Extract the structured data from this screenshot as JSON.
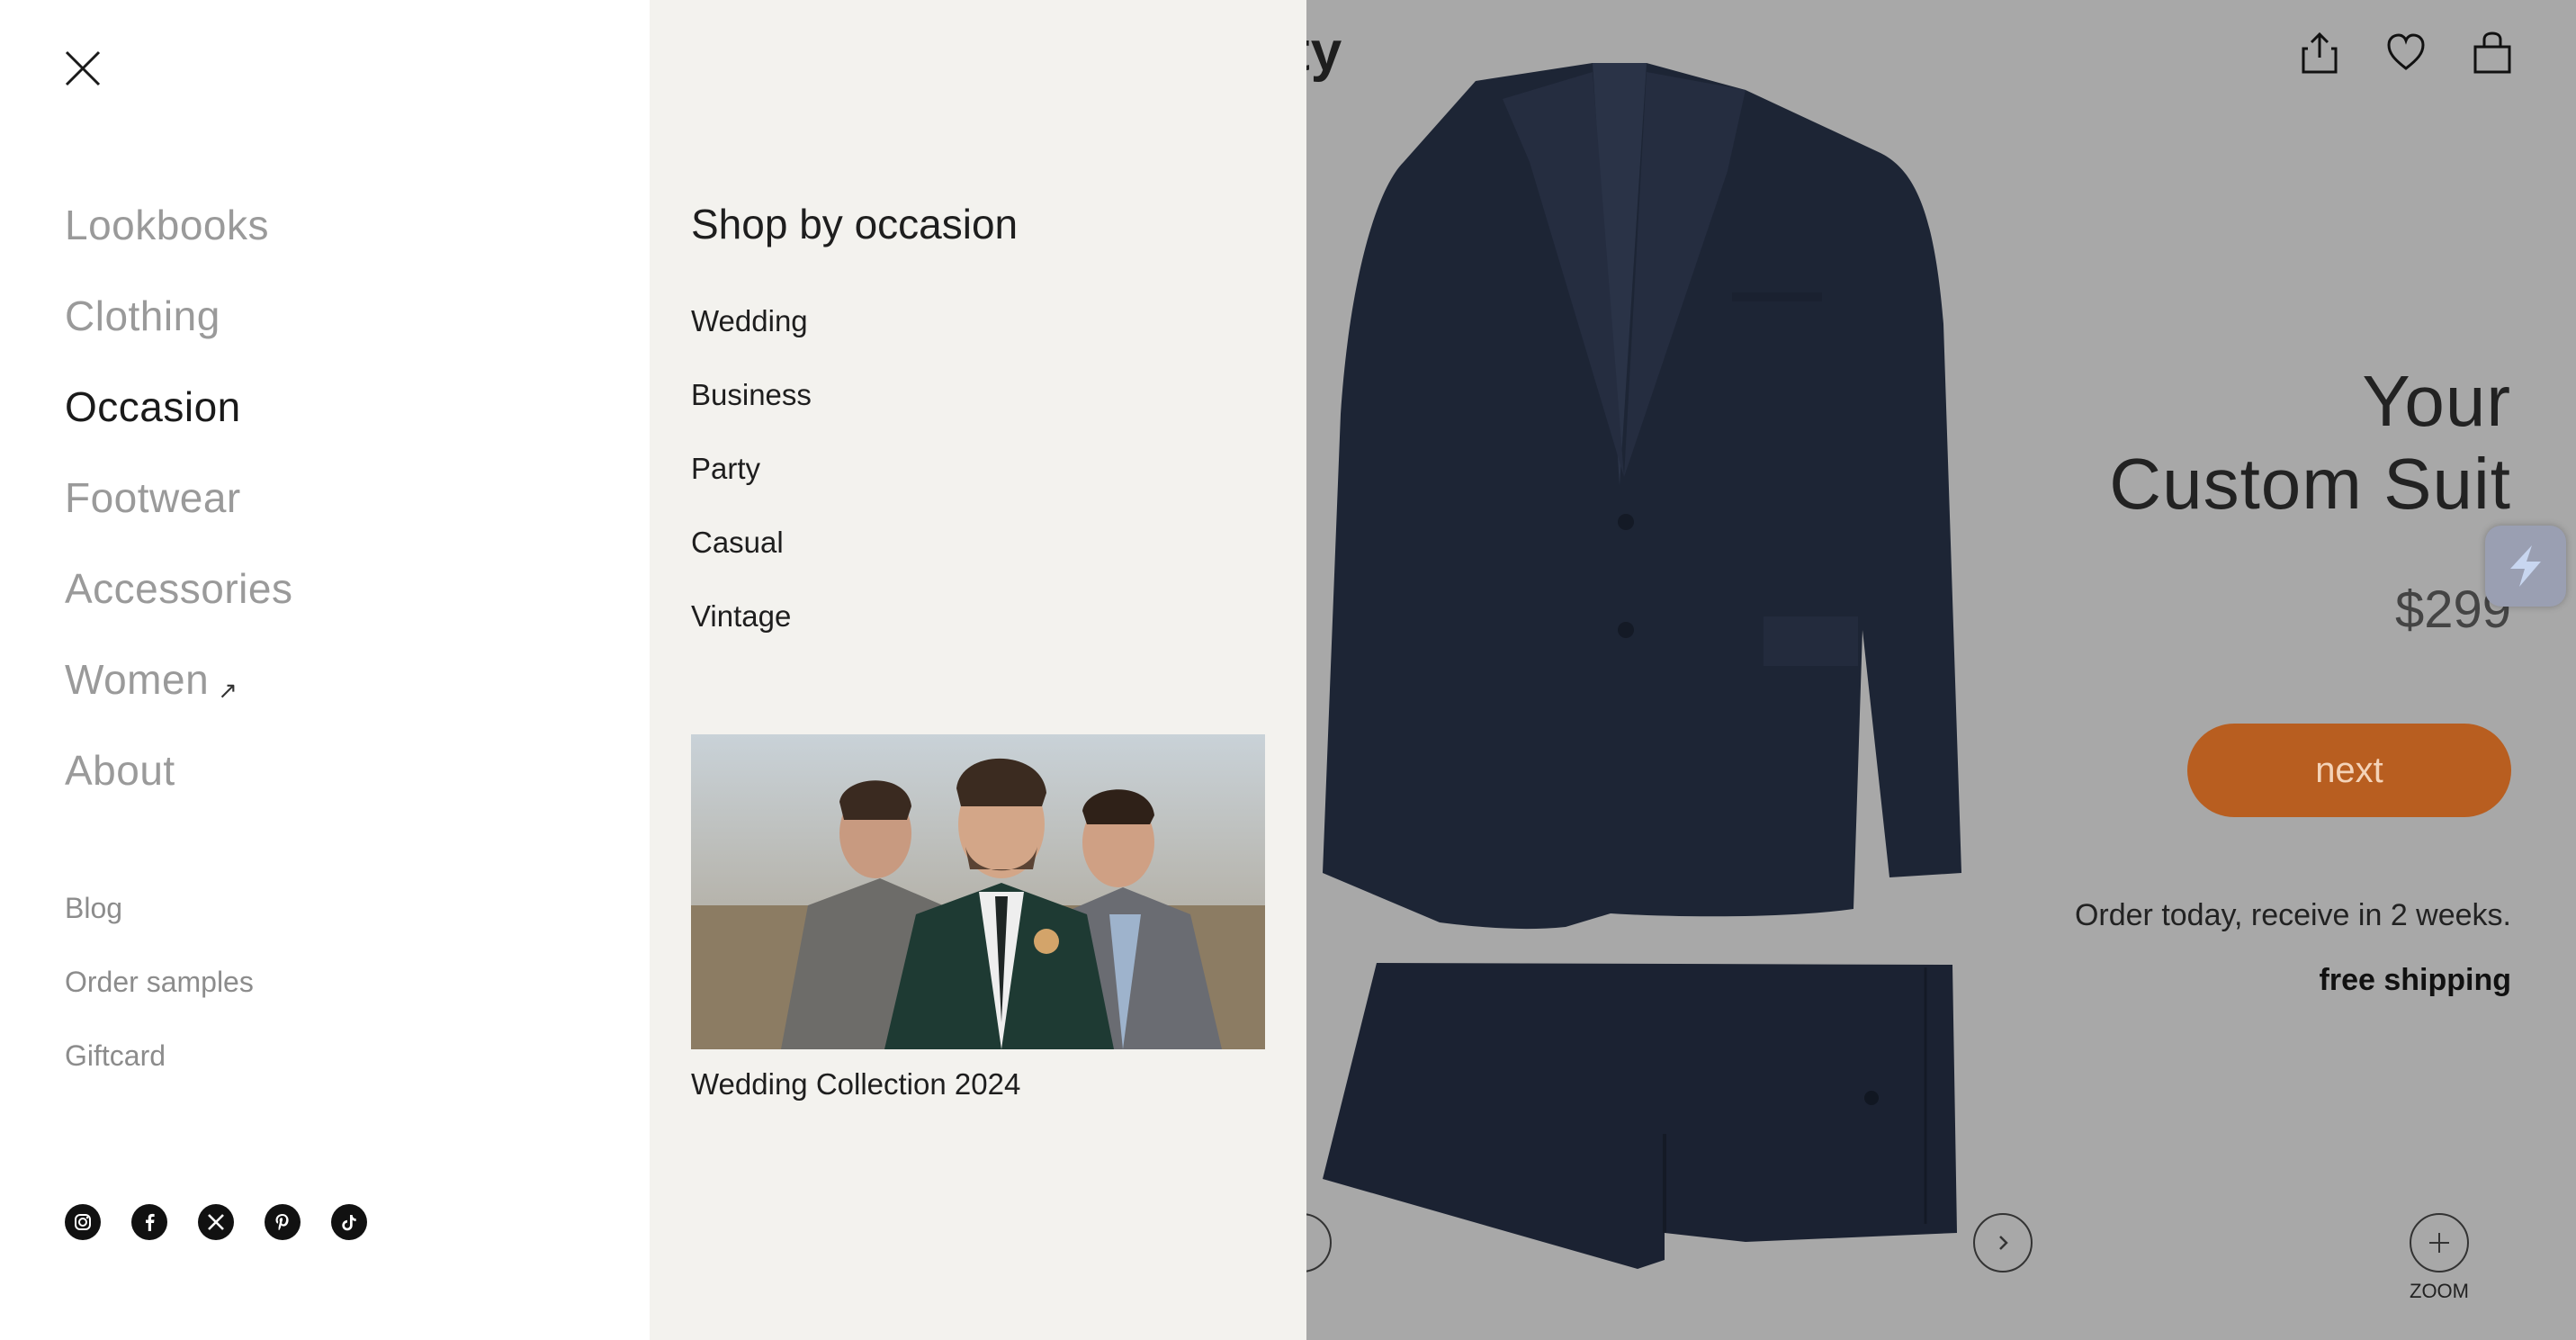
{
  "product": {
    "brand_partial": "rty",
    "title_line1": "Your",
    "title_line2": "Custom Suit",
    "price": "$299",
    "next_label": "next",
    "order_text": "Order today, receive in 2 weeks.",
    "shipping_text": "free shipping",
    "zoom_label": "ZOOM",
    "accent_color": "#b85e20"
  },
  "menu": {
    "main_items": [
      {
        "label": "Lookbooks"
      },
      {
        "label": "Clothing"
      },
      {
        "label": "Occasion"
      },
      {
        "label": "Footwear"
      },
      {
        "label": "Accessories"
      },
      {
        "label": "Women",
        "external_icon": "↗"
      },
      {
        "label": "About"
      }
    ],
    "secondary_items": [
      {
        "label": "Blog"
      },
      {
        "label": "Order samples"
      },
      {
        "label": "Giftcard"
      }
    ],
    "social_icons": [
      "instagram-icon",
      "facebook-icon",
      "x-icon",
      "pinterest-icon",
      "tiktok-icon"
    ]
  },
  "submenu": {
    "title": "Shop by occasion",
    "items": [
      {
        "label": "Wedding"
      },
      {
        "label": "Business"
      },
      {
        "label": "Party"
      },
      {
        "label": "Casual"
      },
      {
        "label": "Vintage"
      }
    ],
    "promo_caption": "Wedding Collection 2024"
  }
}
